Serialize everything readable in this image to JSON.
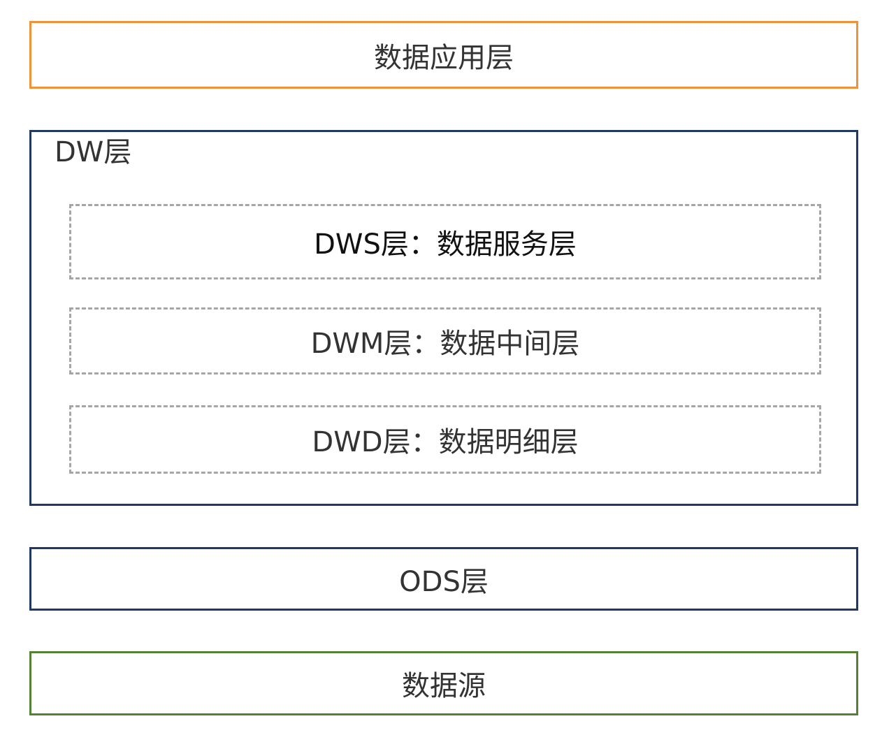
{
  "layers": {
    "app": {
      "label": "数据应用层",
      "color": "#f0923a"
    },
    "dw": {
      "label": "DW层",
      "color": "#1f3864",
      "sublayers": [
        {
          "label": "DWS层：数据服务层"
        },
        {
          "label": "DWM层：数据中间层"
        },
        {
          "label": "DWD层：数据明细层"
        }
      ],
      "sublayer_border_color": "#a6a6a6"
    },
    "ods": {
      "label": "ODS层",
      "color": "#1f3864"
    },
    "source": {
      "label": "数据源",
      "color": "#548235"
    }
  }
}
